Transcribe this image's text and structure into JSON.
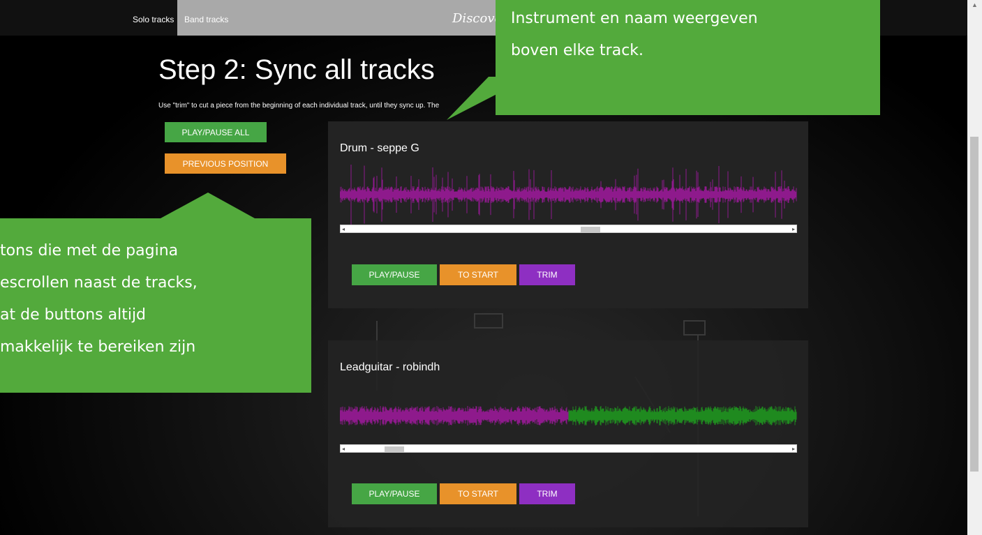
{
  "nav": {
    "solo": "Solo tracks",
    "band": "Band tracks",
    "brand": "Discove"
  },
  "page": {
    "title": "Step 2: Sync all tracks",
    "description": "Use \"trim\" to cut a piece from the beginning of each individual track, until they sync up. The"
  },
  "side_buttons": {
    "play_pause_all": "PLAY/PAUSE ALL",
    "previous_position": "PREVIOUS POSITION"
  },
  "tracks": [
    {
      "title": "Drum - seppe G",
      "play": "PLAY/PAUSE",
      "to_start": "TO START",
      "trim": "TRIM",
      "trimmed_fraction": 0.0,
      "scroll_position": 0.55
    },
    {
      "title": "Leadguitar - robindh",
      "play": "PLAY/PAUSE",
      "to_start": "TO START",
      "trim": "TRIM",
      "trimmed_fraction": 0.5,
      "scroll_position": 0.1
    }
  ],
  "callouts": {
    "top": [
      "Instrument en naam weergeven",
      "boven elke track."
    ],
    "left": [
      "tons die met de pagina",
      "escrollen naast de tracks,",
      "at de buttons altijd",
      "makkelijk te bereiken zijn"
    ]
  },
  "colors": {
    "green": "#46a645",
    "orange": "#e8922a",
    "purple": "#8e2fc2",
    "wave_played": "#8e1a8c",
    "wave_unplayed": "#1f8a1f",
    "callout": "#53aa3c"
  }
}
